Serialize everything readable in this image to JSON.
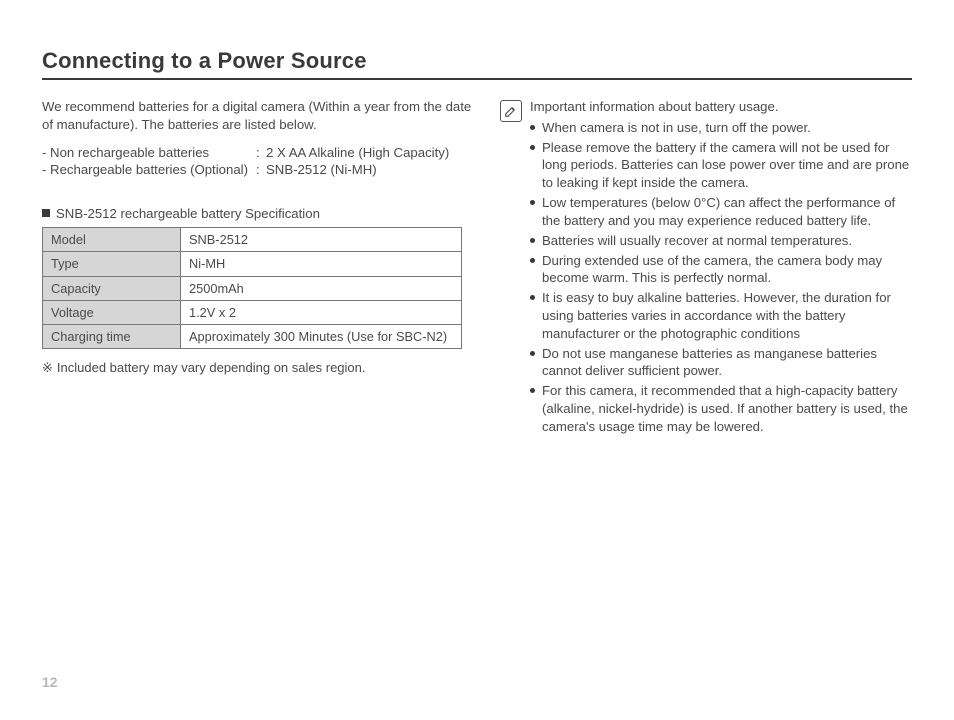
{
  "title": "Connecting to a Power Source",
  "intro": "We recommend batteries for a digital camera (Within a year from the date of manufacture). The batteries are listed below.",
  "batteryLines": [
    {
      "label": "- Non rechargeable batteries",
      "value": "2 X AA Alkaline (High Capacity)"
    },
    {
      "label": "- Rechargeable batteries (Optional)",
      "value": "SNB-2512 (Ni-MH)"
    }
  ],
  "specHeader": "SNB-2512 rechargeable battery Specification",
  "specTable": [
    {
      "k": "Model",
      "v": "SNB-2512"
    },
    {
      "k": "Type",
      "v": "Ni-MH"
    },
    {
      "k": "Capacity",
      "v": "2500mAh"
    },
    {
      "k": "Voltage",
      "v": "1.2V x 2"
    },
    {
      "k": "Charging time",
      "v": "Approximately 300 Minutes (Use for SBC-N2)"
    }
  ],
  "footnoteSymbol": "※",
  "footnote": "Included battery may vary depending on sales region.",
  "note": {
    "lead": "Important information about battery usage.",
    "bullets": [
      "When camera is not in use, turn off the power.",
      "Please remove the battery if the camera will not be used for long periods. Batteries can lose power over time and are prone to leaking if kept inside the camera.",
      "Low temperatures (below 0°C) can affect the performance of the battery and you may experience reduced battery life.",
      "Batteries will usually recover at normal temperatures.",
      "During extended use of the camera, the camera body may become warm. This is perfectly normal.",
      "It is easy to buy alkaline batteries. However, the duration for using batteries varies in accordance with the battery manufacturer or the photographic conditions",
      "Do not use manganese batteries as manganese batteries cannot deliver sufficient power.",
      "For this camera, it recommended that a high-capacity battery (alkaline, nickel-hydride) is used. If another battery is used, the camera's usage time may be lowered."
    ]
  },
  "pageNumber": "12"
}
